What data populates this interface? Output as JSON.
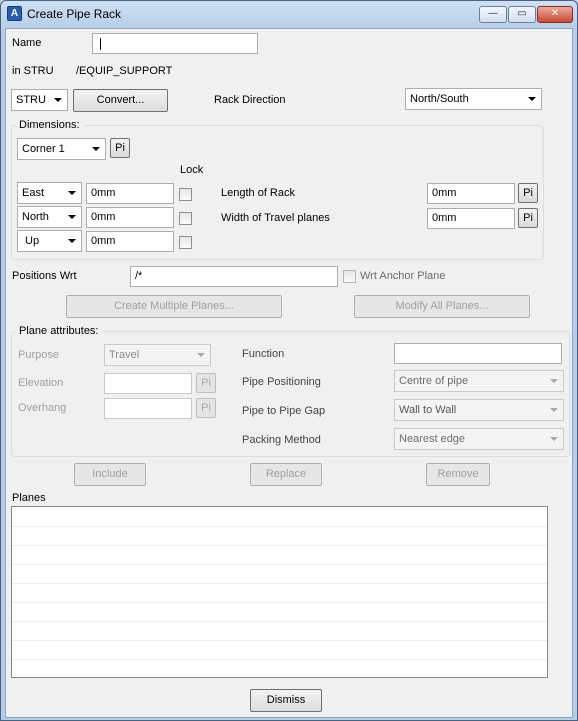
{
  "window": {
    "title": "Create Pipe Rack",
    "app_icon_letter": "A",
    "minimize_glyph": "—",
    "maximize_glyph": "▭",
    "close_glyph": "✕"
  },
  "form": {
    "name_label": "Name",
    "name_value": "",
    "in_label": "in STRU",
    "in_value": "/EQUIP_SUPPORT",
    "type_select": "STRU",
    "convert_button": "Convert...",
    "rack_direction_label": "Rack Direction",
    "rack_direction_value": "North/South"
  },
  "dimensions": {
    "title": "Dimensions:",
    "corner_select": "Corner 1",
    "corner_pi": "Pi",
    "lock_label": "Lock",
    "rows": [
      {
        "direction": "East",
        "value": "0mm"
      },
      {
        "direction": "North",
        "value": "0mm"
      },
      {
        "direction": "Up",
        "value": "0mm"
      }
    ],
    "length_label": "Length of Rack",
    "length_value": "0mm",
    "length_pi": "Pi",
    "width_label": "Width of Travel planes",
    "width_value": "0mm",
    "width_pi": "Pi"
  },
  "positions": {
    "label": "Positions Wrt",
    "value": "/*",
    "anchor_label": "Wrt Anchor Plane",
    "create_multiple_button": "Create Multiple Planes...",
    "modify_all_button": "Modify All Planes..."
  },
  "plane_attributes": {
    "title": "Plane attributes:",
    "purpose_label": "Purpose",
    "purpose_value": "Travel",
    "elevation_label": "Elevation",
    "elevation_value": "",
    "elevation_pi": "Pi",
    "overhang_label": "Overhang",
    "overhang_value": "",
    "overhang_pi": "Pi",
    "function_label": "Function",
    "function_value": "",
    "pipe_positioning_label": "Pipe Positioning",
    "pipe_positioning_value": "Centre of pipe",
    "pipe_gap_label": "Pipe to Pipe Gap",
    "pipe_gap_value": "Wall to Wall",
    "packing_label": "Packing Method",
    "packing_value": "Nearest edge"
  },
  "actions": {
    "include": "Include",
    "replace": "Replace",
    "remove": "Remove"
  },
  "planes": {
    "label": "Planes",
    "items": []
  },
  "footer": {
    "dismiss": "Dismiss"
  }
}
